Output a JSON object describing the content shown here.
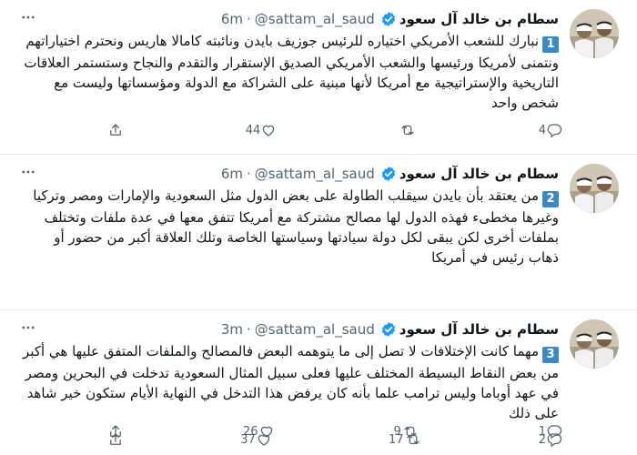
{
  "tweets": [
    {
      "name": "سطام بن خالد آل سعود",
      "handle": "@sattam_al_saud",
      "dot": "·",
      "time": "6m",
      "number": "1",
      "text": "نبارك للشعب الأمريكي اختياره للرئيس جوزيف بايدن ونائبته كامالا هاريس ونحترم اختياراتهم ونتمنى لأمريكا ورئيسها والشعب الأمريكي الصديق الإستقرار والتقدم والنجاح وستستمر العلاقات التاريخية والإستراتيجية مع أمريكا لأنها مبنية على الشراكة مع الدولة ومؤسساتها وليست مع شخص واحد",
      "replies": "4",
      "retweets": "",
      "likes": "44"
    },
    {
      "name": "سطام بن خالد آل سعود",
      "handle": "@sattam_al_saud",
      "dot": "·",
      "time": "6m",
      "number": "2",
      "text": "من يعتقد بأن بايدن سيقلب الطاولة على بعض الدول مثل السعودية والإمارات ومصر وتركيا وغيرها مخطىء فهذه الدول لها مصالح مشتركة مع أمريكا تتفق معها في عدة ملفات وتختلف بملفات أخرى لكن يبقى لكل دولة سيادتها وسياستها الخاصة وتلك العلاقة أكبر من حضور أو ذهاب رئيس في أمريكا",
      "replies": "2",
      "retweets": "17",
      "likes": "37"
    },
    {
      "name": "سطام بن خالد آل سعود",
      "handle": "@sattam_al_saud",
      "dot": "·",
      "time": "3m",
      "number": "3",
      "text": "مهما كانت الإختلافات لا تصل إلى ما يتوهمه البعض فالمصالح والملفات المتفق عليها هي أكبر من بعض النقاط البسيطة المختلف عليها فعلى سبيل المثال السعودية تدخلت في البحرين ومصر في عهد أوباما وليس ترامب علما بأنه كان يرفض هذا التدخل في النهاية الأيام ستكون خير شاهد على ذلك",
      "replies": "1",
      "retweets": "9",
      "likes": "26"
    }
  ],
  "colors": {
    "text": "#0f1419",
    "muted": "#536471",
    "verified": "#1d9bf0",
    "badge": "#3b88c3",
    "divider": "#e6ecf0"
  },
  "icons": {
    "verified": "verified-badge-icon",
    "reply": "reply-icon",
    "retweet": "retweet-icon",
    "like": "heart-icon",
    "share": "share-icon",
    "more": "more-icon"
  }
}
